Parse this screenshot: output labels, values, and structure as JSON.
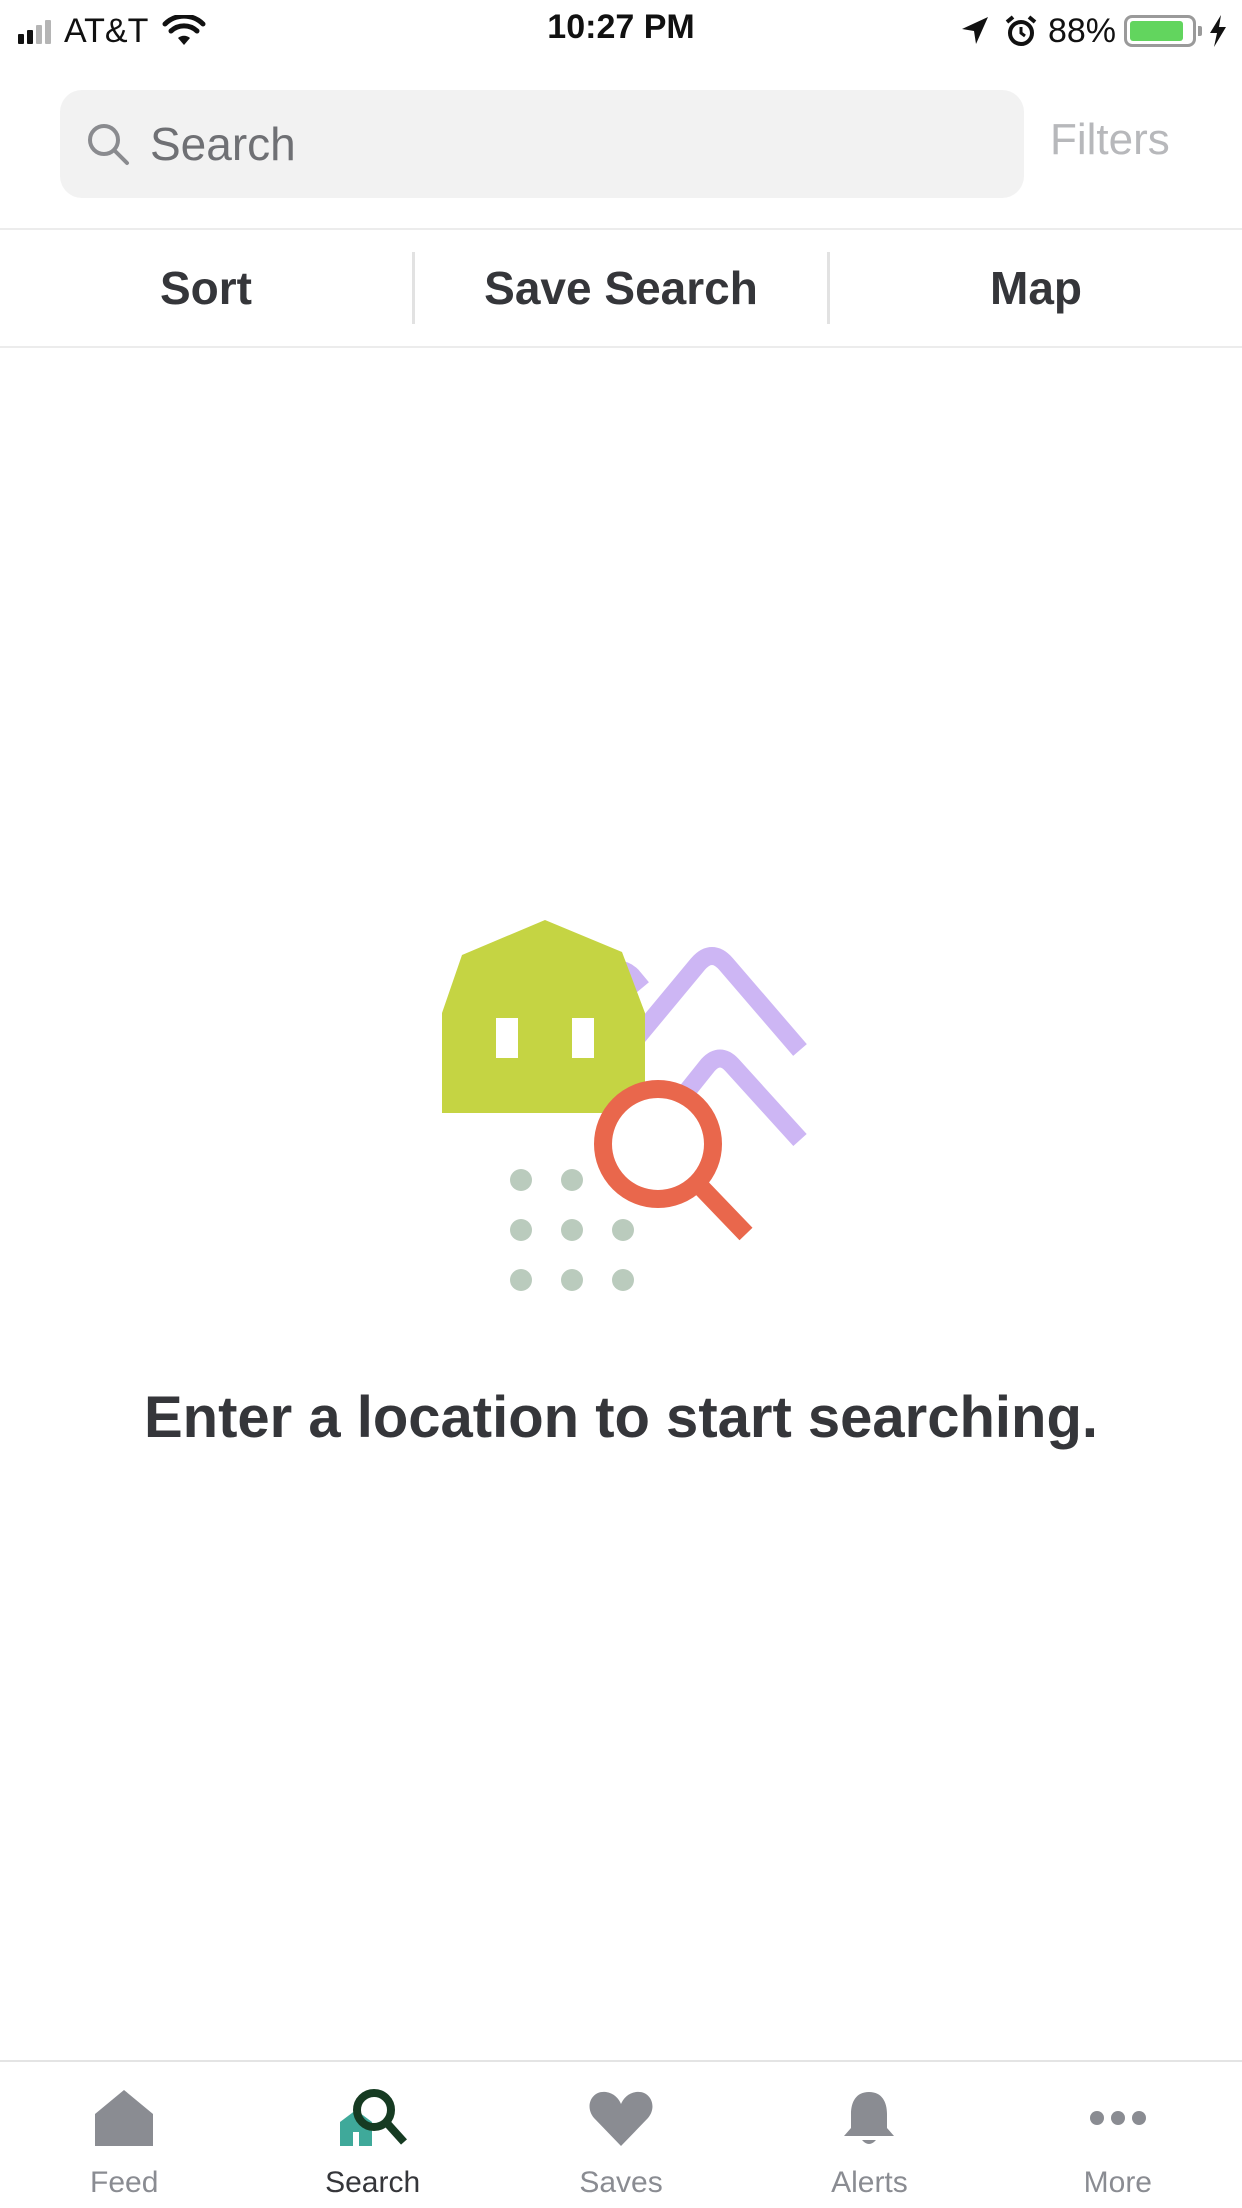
{
  "status_bar": {
    "carrier": "AT&T",
    "time": "10:27 PM",
    "battery_percent": "88%",
    "battery_level": 0.88,
    "icons": [
      "signal-icon",
      "wifi-icon",
      "location-arrow-icon",
      "alarm-icon",
      "battery-icon",
      "charging-bolt-icon"
    ]
  },
  "search": {
    "placeholder": "Search",
    "value": "",
    "filters_label": "Filters"
  },
  "actions": {
    "sort_label": "Sort",
    "save_search_label": "Save Search",
    "map_label": "Map"
  },
  "empty_state": {
    "message": "Enter a location to start searching."
  },
  "tabs": [
    {
      "label": "Feed",
      "icon": "house-icon",
      "active": false
    },
    {
      "label": "Search",
      "icon": "search-house-icon",
      "active": true
    },
    {
      "label": "Saves",
      "icon": "heart-icon",
      "active": false
    },
    {
      "label": "Alerts",
      "icon": "bell-icon",
      "active": false
    },
    {
      "label": "More",
      "icon": "more-dots-icon",
      "active": false
    }
  ],
  "colors": {
    "text_primary": "#35363a",
    "text_muted": "#8a8c92",
    "illustration_barn": "#c5d443",
    "illustration_hills": "#cdb6f4",
    "illustration_magnifier": "#e9674c",
    "illustration_dots": "#bacbbd",
    "active_tab_house": "#3fa99a",
    "active_tab_magnifier": "#163b22"
  }
}
